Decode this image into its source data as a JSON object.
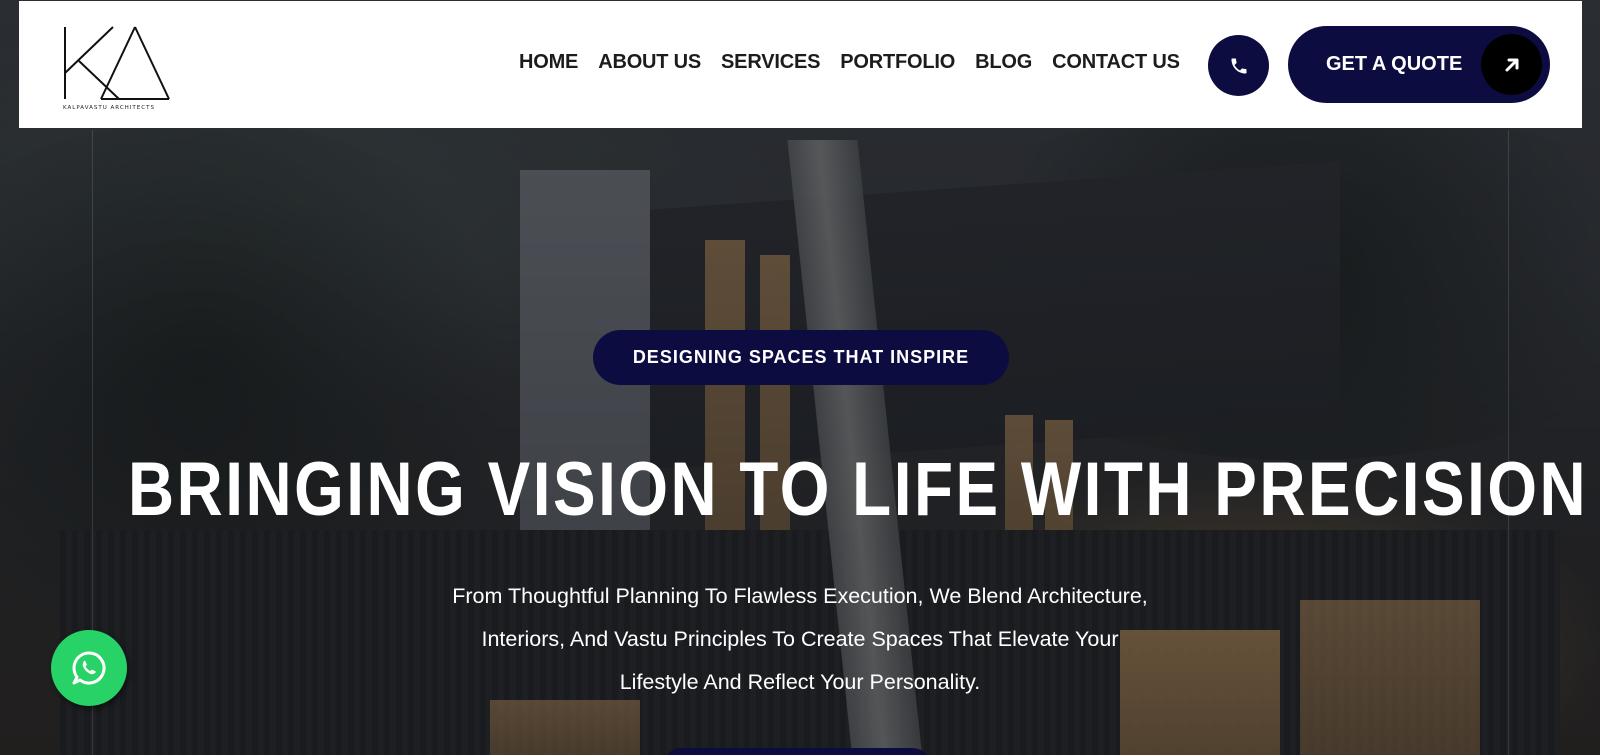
{
  "brand": {
    "monogram": "KA",
    "caption": "KALPAVASTU ARCHITECTS"
  },
  "nav": {
    "items": [
      {
        "label": "HOME"
      },
      {
        "label": "ABOUT US"
      },
      {
        "label": "SERVICES"
      },
      {
        "label": "PORTFOLIO"
      },
      {
        "label": "BLOG"
      },
      {
        "label": "CONTACT US"
      }
    ]
  },
  "header_actions": {
    "phone_icon": "phone-icon",
    "quote_label": "GET A QUOTE",
    "quote_icon": "arrow-up-right-icon"
  },
  "hero": {
    "tagline": "DESIGNING SPACES THAT INSPIRE",
    "headline": "BRINGING VISION TO LIFE WITH PRECISION",
    "subtext_lines": [
      "From Thoughtful Planning To Flawless Execution, We Blend Architecture,",
      "Interiors, And Vastu Principles To Create Spaces That Elevate Your",
      "Lifestyle And Reflect Your Personality."
    ]
  },
  "floating": {
    "whatsapp_icon": "whatsapp-icon"
  },
  "colors": {
    "navy": "#0d0c40",
    "whatsapp": "#27d366",
    "header_bg": "#ffffff",
    "nav_text": "#1c1c1c"
  }
}
